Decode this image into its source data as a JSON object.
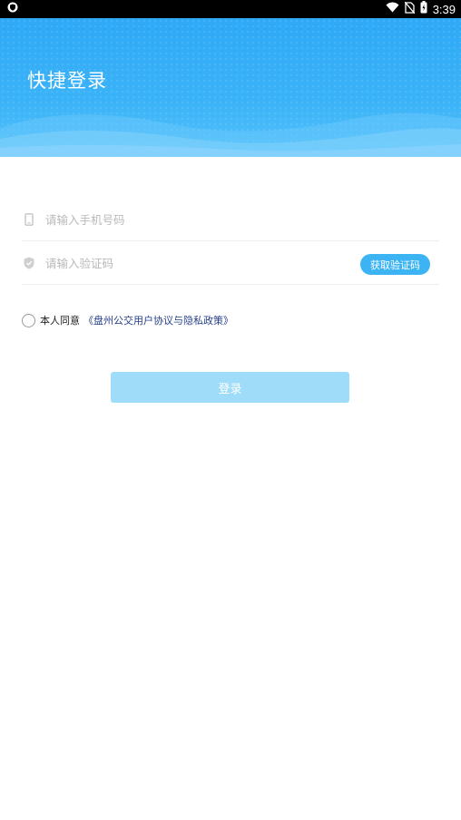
{
  "status_bar": {
    "time": "3:39",
    "icons": [
      "shield-notification-icon",
      "wifi-icon",
      "no-sim-icon",
      "battery-charging-icon"
    ]
  },
  "header": {
    "title": "快捷登录"
  },
  "form": {
    "phone": {
      "placeholder": "请输入手机号码",
      "value": "",
      "icon": "phone-icon"
    },
    "code": {
      "placeholder": "请输入验证码",
      "value": "",
      "icon": "shield-icon"
    },
    "get_code_label": "获取验证码"
  },
  "agreement": {
    "checked": false,
    "prefix": "本人同意",
    "link": "《盘州公交用户协议与隐私政策》"
  },
  "login_label": "登录",
  "colors": {
    "accent": "#3cb4f4",
    "header_bg": "#2fa9f6",
    "login_disabled": "#9fdcfa",
    "link": "#27408b"
  }
}
